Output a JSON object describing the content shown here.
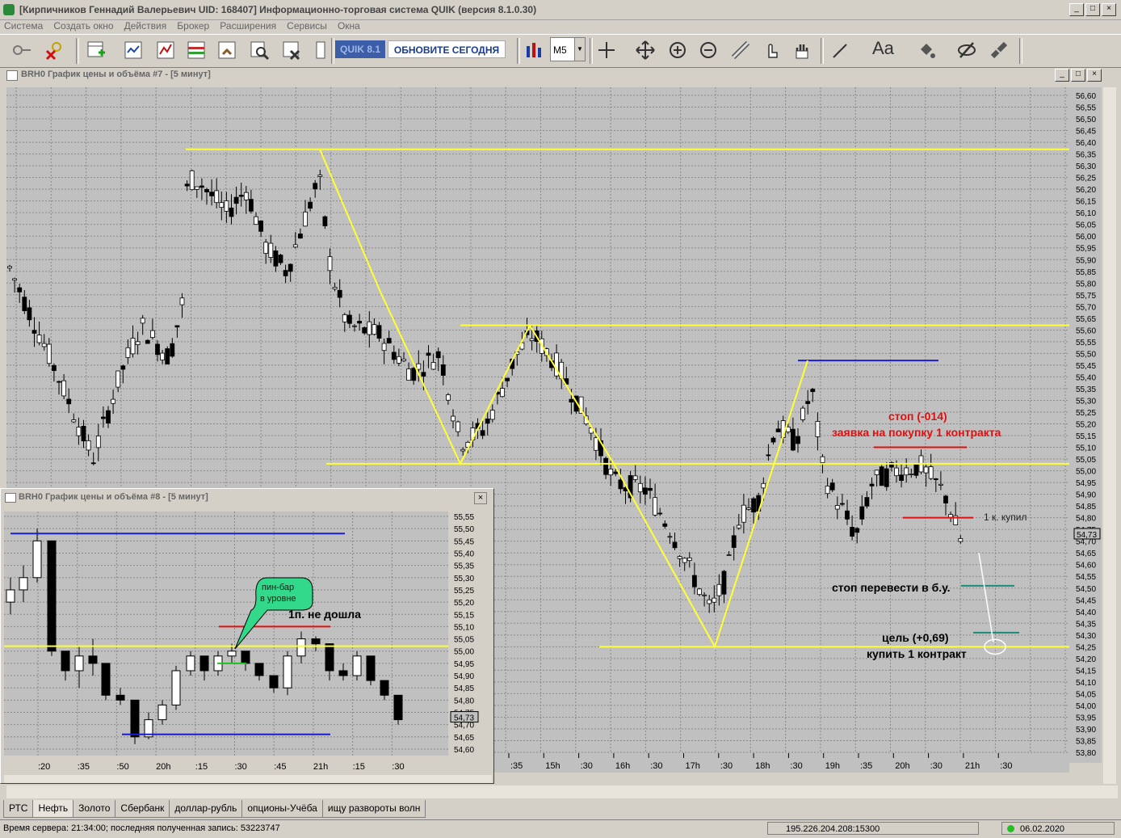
{
  "window": {
    "title": "[Кирпичников Геннадий Валерьевич UID: 168407] Информационно-торговая система QUIK (версия 8.1.0.30)"
  },
  "menu": [
    "Система",
    "Создать окно",
    "Действия",
    "Брокер",
    "Расширения",
    "Сервисы",
    "Окна"
  ],
  "toolbar": {
    "quik_badge": "QUIK 8.1",
    "update_label": "ОБНОВИТЕ СЕГОДНЯ",
    "timeframe": "M5",
    "font_label": "Aa"
  },
  "colors": {
    "chart_bg": "#c0c0c0",
    "grid": "#8a8a8a",
    "level": "#ffff33",
    "blue": "#1c1cd0",
    "red": "#e01010",
    "teal": "#1a8a7a",
    "green": "#22c022",
    "candle": "#000000",
    "up_candle": "#ffffff"
  },
  "main_chart": {
    "title": "BRH0 График цены и объёма #7 - [5 минут]",
    "price_labels": [
      "56,60",
      "56,55",
      "56,50",
      "56,45",
      "56,40",
      "56,35",
      "56,30",
      "56,25",
      "56,20",
      "56,15",
      "56,10",
      "56,05",
      "56,00",
      "55,95",
      "55,90",
      "55,85",
      "55,80",
      "55,75",
      "55,70",
      "55,65",
      "55,60",
      "55,55",
      "55,50",
      "55,45",
      "55,40",
      "55,35",
      "55,30",
      "55,25",
      "55,20",
      "55,15",
      "55,10",
      "55,05",
      "55,00",
      "54,95",
      "54,90",
      "54,85",
      "54,80",
      "54,75",
      "54,70",
      "54,65",
      "54,60",
      "54,55",
      "54,50",
      "54,45",
      "54,40",
      "54,35",
      "54,30",
      "54,25",
      "54,20",
      "54,15",
      "54,10",
      "54,05",
      "54,00",
      "53,95",
      "53,90",
      "53,85",
      "53,80"
    ],
    "current_price": "54,73",
    "time_labels": [
      ":35",
      "15h",
      ":30",
      "16h",
      ":30",
      "17h",
      ":30",
      "18h",
      ":30",
      "19h",
      ":35",
      "20h",
      ":30",
      "21h",
      ":30"
    ],
    "annotations": {
      "stop": "стоп  (-014)",
      "order": "заявка на покупку 1 контракта",
      "bought": "1 к. купил",
      "move_stop": "стоп перевести в б.у.",
      "target": "цель (+0,69)",
      "buy": "купить 1 контракт"
    }
  },
  "sub_chart": {
    "title": "BRH0 График цены и объёма #8 - [5 минут]",
    "price_labels": [
      "55,55",
      "55,50",
      "55,45",
      "55,40",
      "55,35",
      "55,30",
      "55,25",
      "55,20",
      "55,15",
      "55,10",
      "55,05",
      "55,00",
      "54,95",
      "54,90",
      "54,85",
      "54,80",
      "54,75",
      "54,70",
      "54,65",
      "54,60"
    ],
    "current_price": "54,73",
    "time_labels": [
      ":20",
      ":35",
      ":50",
      "20h",
      ":15",
      ":30",
      ":45",
      "21h",
      ":15",
      ":30"
    ],
    "callout_line1": "пин-бар",
    "callout_line2": "в уровне",
    "note": "1п. не дошла"
  },
  "tabs": [
    "РТС",
    "Нефть",
    "Золото",
    "Сбербанк",
    "доллар-рубль",
    "опционы-Учёба",
    "ищу развороты волн"
  ],
  "active_tab": "Нефть",
  "status": {
    "server_time": "Время сервера: 21:34:00; последняя полученная запись: 53223747",
    "connection": "195.226.204.208:15300",
    "date": "06.02.2020"
  }
}
